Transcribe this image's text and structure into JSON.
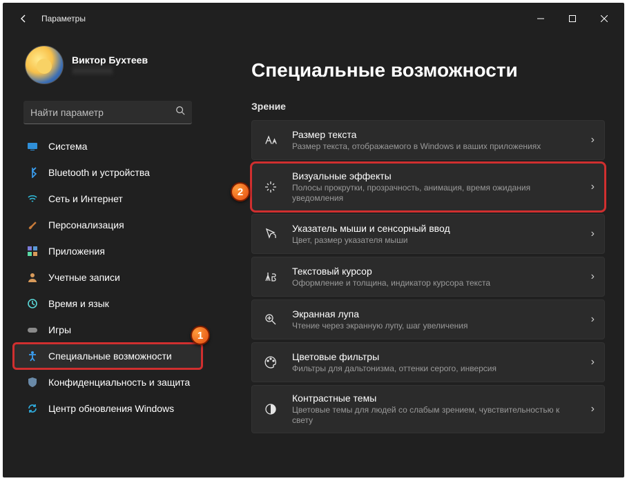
{
  "window": {
    "title": "Параметры"
  },
  "profile": {
    "name": "Виктор Бухтеев",
    "email": "··············"
  },
  "search": {
    "placeholder": "Найти параметр"
  },
  "nav": [
    {
      "key": "system",
      "label": "Система"
    },
    {
      "key": "bluetooth",
      "label": "Bluetooth и устройства"
    },
    {
      "key": "network",
      "label": "Сеть и Интернет"
    },
    {
      "key": "personalization",
      "label": "Персонализация"
    },
    {
      "key": "apps",
      "label": "Приложения"
    },
    {
      "key": "accounts",
      "label": "Учетные записи"
    },
    {
      "key": "time",
      "label": "Время и язык"
    },
    {
      "key": "gaming",
      "label": "Игры"
    },
    {
      "key": "accessibility",
      "label": "Специальные возможности"
    },
    {
      "key": "privacy",
      "label": "Конфиденциальность и защита"
    },
    {
      "key": "update",
      "label": "Центр обновления Windows"
    }
  ],
  "page": {
    "title": "Специальные возможности",
    "section": "Зрение",
    "items": [
      {
        "title": "Размер текста",
        "desc": "Размер текста, отображаемого в Windows и ваших приложениях"
      },
      {
        "title": "Визуальные эффекты",
        "desc": "Полосы прокрутки, прозрачность, анимация, время ожидания уведомления"
      },
      {
        "title": "Указатель мыши и сенсорный ввод",
        "desc": "Цвет, размер указателя мыши"
      },
      {
        "title": "Текстовый курсор",
        "desc": "Оформление и толщина, индикатор курсора текста"
      },
      {
        "title": "Экранная лупа",
        "desc": "Чтение через экранную лупу, шаг увеличения"
      },
      {
        "title": "Цветовые фильтры",
        "desc": "Фильтры для дальтонизма, оттенки серого, инверсия"
      },
      {
        "title": "Контрастные темы",
        "desc": "Цветовые темы для людей со слабым зрением, чувствительностью к свету"
      }
    ]
  },
  "callouts": {
    "one": "1",
    "two": "2"
  }
}
